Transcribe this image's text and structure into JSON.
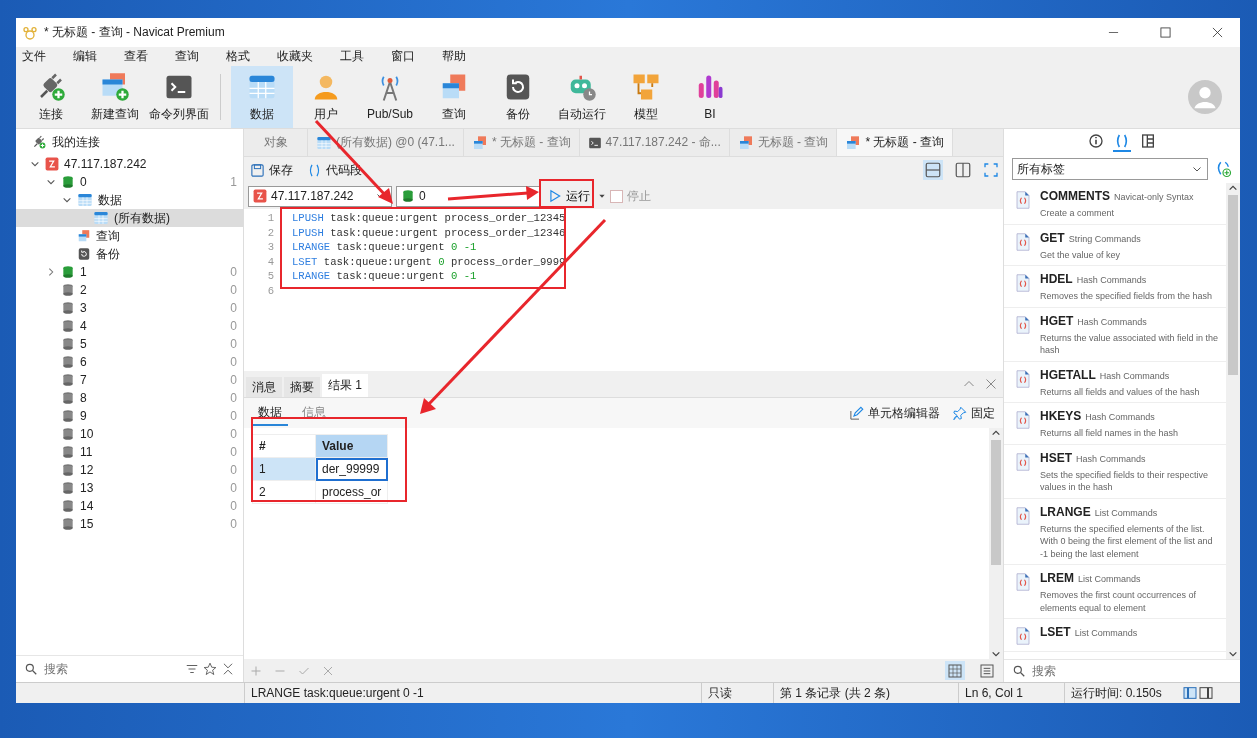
{
  "window": {
    "title": "* 无标题 - 查询 - Navicat Premium"
  },
  "menu": [
    "文件",
    "编辑",
    "查看",
    "查询",
    "格式",
    "收藏夹",
    "工具",
    "窗口",
    "帮助"
  ],
  "toolbar_left": [
    {
      "label": "连接",
      "selected": false
    },
    {
      "label": "新建查询",
      "selected": false
    },
    {
      "label": "命令列界面",
      "selected": false
    }
  ],
  "toolbar_main": [
    {
      "label": "数据",
      "selected": true
    },
    {
      "label": "用户",
      "selected": false
    },
    {
      "label": "Pub/Sub",
      "selected": false
    },
    {
      "label": "查询",
      "selected": false
    },
    {
      "label": "备份",
      "selected": false
    },
    {
      "label": "自动运行",
      "selected": false
    },
    {
      "label": "模型",
      "selected": false
    },
    {
      "label": "BI",
      "selected": false
    }
  ],
  "sidebar": {
    "title": "我的连接",
    "search_placeholder": "搜索",
    "tree": [
      {
        "label": "47.117.187.242",
        "kind": "connection",
        "expanded": true,
        "selected": false,
        "children": [
          {
            "label": "0",
            "kind": "database",
            "opened": true,
            "expanded": true,
            "selected": false,
            "count": "1",
            "children": [
              {
                "label": "数据",
                "kind": "data",
                "expanded": true,
                "selected": false,
                "children": [
                  {
                    "label": "(所有数据)",
                    "kind": "data",
                    "selected": true
                  }
                ]
              },
              {
                "label": "查询",
                "kind": "query",
                "selected": false
              },
              {
                "label": "备份",
                "kind": "backup",
                "selected": false
              }
            ]
          },
          {
            "label": "1",
            "kind": "database",
            "opened": true,
            "expanded": false,
            "selected": false,
            "count": "0"
          },
          {
            "label": "2",
            "kind": "database",
            "opened": false,
            "selected": false,
            "count": "0"
          },
          {
            "label": "3",
            "kind": "database",
            "opened": false,
            "selected": false,
            "count": "0"
          },
          {
            "label": "4",
            "kind": "database",
            "opened": false,
            "selected": false,
            "count": "0"
          },
          {
            "label": "5",
            "kind": "database",
            "opened": false,
            "selected": false,
            "count": "0"
          },
          {
            "label": "6",
            "kind": "database",
            "opened": false,
            "selected": false,
            "count": "0"
          },
          {
            "label": "7",
            "kind": "database",
            "opened": false,
            "selected": false,
            "count": "0"
          },
          {
            "label": "8",
            "kind": "database",
            "opened": false,
            "selected": false,
            "count": "0"
          },
          {
            "label": "9",
            "kind": "database",
            "opened": false,
            "selected": false,
            "count": "0"
          },
          {
            "label": "10",
            "kind": "database",
            "opened": false,
            "selected": false,
            "count": "0"
          },
          {
            "label": "11",
            "kind": "database",
            "opened": false,
            "selected": false,
            "count": "0"
          },
          {
            "label": "12",
            "kind": "database",
            "opened": false,
            "selected": false,
            "count": "0"
          },
          {
            "label": "13",
            "kind": "database",
            "opened": false,
            "selected": false,
            "count": "0"
          },
          {
            "label": "14",
            "kind": "database",
            "opened": false,
            "selected": false,
            "count": "0"
          },
          {
            "label": "15",
            "kind": "database",
            "opened": false,
            "selected": false,
            "count": "0"
          }
        ]
      }
    ]
  },
  "editor_tabs": [
    {
      "label": "对象",
      "kind": "object",
      "selected": false
    },
    {
      "label": "(所有数据) @0 (47.1...",
      "kind": "data",
      "selected": false
    },
    {
      "label": "* 无标题 - 查询",
      "kind": "query",
      "selected": false
    },
    {
      "label": "47.117.187.242 - 命...",
      "kind": "console",
      "selected": false
    },
    {
      "label": "无标题 - 查询",
      "kind": "query",
      "selected": false
    },
    {
      "label": "* 无标题 - 查询",
      "kind": "query",
      "selected": true
    }
  ],
  "query_toolbar": {
    "save": "保存",
    "snippet": "代码段",
    "layout_modes": [
      {
        "kind": "stacked",
        "selected": true
      },
      {
        "kind": "side",
        "selected": false
      }
    ]
  },
  "query_bar": {
    "connection": "47.117.187.242",
    "database": "0",
    "run": "运行",
    "stop": {
      "label": "停止",
      "disabled": true
    }
  },
  "code": [
    {
      "number": "1",
      "tokens": [
        {
          "kind": "keyword",
          "text": "LPUSH"
        },
        {
          "kind": "plain",
          "text": " task:queue:urgent process_order_12345"
        }
      ]
    },
    {
      "number": "2",
      "tokens": [
        {
          "kind": "keyword",
          "text": "LPUSH"
        },
        {
          "kind": "plain",
          "text": " task:queue:urgent process_order_12346"
        }
      ]
    },
    {
      "number": "3",
      "tokens": [
        {
          "kind": "keyword",
          "text": "LRANGE"
        },
        {
          "kind": "plain",
          "text": " task:queue:urgent "
        },
        {
          "kind": "number",
          "text": "0 -1"
        }
      ]
    },
    {
      "number": "4",
      "tokens": [
        {
          "kind": "keyword",
          "text": "LSET"
        },
        {
          "kind": "plain",
          "text": " task:queue:urgent "
        },
        {
          "kind": "number",
          "text": "0"
        },
        {
          "kind": "plain",
          "text": " process_order_9999"
        }
      ]
    },
    {
      "number": "5",
      "tokens": [
        {
          "kind": "keyword",
          "text": "LRANGE"
        },
        {
          "kind": "plain",
          "text": " task:queue:urgent "
        },
        {
          "kind": "number",
          "text": "0 -1"
        }
      ]
    },
    {
      "number": "6"
    }
  ],
  "result_tabs": [
    {
      "label": "消息",
      "selected": false
    },
    {
      "label": "摘要",
      "selected": false
    },
    {
      "label": "结果 1",
      "selected": true
    }
  ],
  "result_subtabs": [
    {
      "label": "数据",
      "selected": true
    },
    {
      "label": "信息",
      "selected": false
    }
  ],
  "result_actions": [
    "单元格编辑器",
    "固定"
  ],
  "grid": {
    "columns": [
      "#",
      "Value"
    ],
    "rows": [
      {
        "selected": true,
        "cells": [
          "1",
          "der_99999"
        ],
        "editing": true
      },
      {
        "selected": false,
        "cells": [
          "2",
          "process_or"
        ],
        "editing": false
      }
    ]
  },
  "grid_view_modes": [
    {
      "kind": "grid",
      "selected": true
    },
    {
      "kind": "form",
      "selected": false
    }
  ],
  "status_bar": {
    "sql": "LRANGE task:queue:urgent 0 -1",
    "mode": "只读",
    "record": "第 1 条记录 (共 2 条)",
    "cursor": "Ln 6, Col 1",
    "time": "运行时间: 0.150s"
  },
  "snippets_panel": {
    "tabs": [
      {
        "kind": "info",
        "selected": false
      },
      {
        "kind": "snippet",
        "selected": true
      },
      {
        "kind": "layout",
        "selected": false
      }
    ],
    "filter": "所有标签",
    "search_placeholder": "搜索",
    "items": [
      {
        "name": "COMMENTS",
        "category": "Navicat-only Syntax",
        "description": "Create a comment"
      },
      {
        "name": "GET",
        "category": "String Commands",
        "description": "Get the value of key"
      },
      {
        "name": "HDEL",
        "category": "Hash Commands",
        "description": "Removes the specified fields from the hash"
      },
      {
        "name": "HGET",
        "category": "Hash Commands",
        "description": "Returns the value associated with field in the hash"
      },
      {
        "name": "HGETALL",
        "category": "Hash Commands",
        "description": "Returns all fields and values of the hash"
      },
      {
        "name": "HKEYS",
        "category": "Hash Commands",
        "description": "Returns all field names in the hash"
      },
      {
        "name": "HSET",
        "category": "Hash Commands",
        "description": "Sets the specified fields to their respective values in the hash"
      },
      {
        "name": "LRANGE",
        "category": "List Commands",
        "description": "Returns the specified elements of the list. With 0 being the first element of the list and -1 being the last element"
      },
      {
        "name": "LREM",
        "category": "List Commands",
        "description": "Removes the first count occurrences of elements equal to element"
      },
      {
        "name": "LSET",
        "category": "List Commands"
      }
    ]
  }
}
